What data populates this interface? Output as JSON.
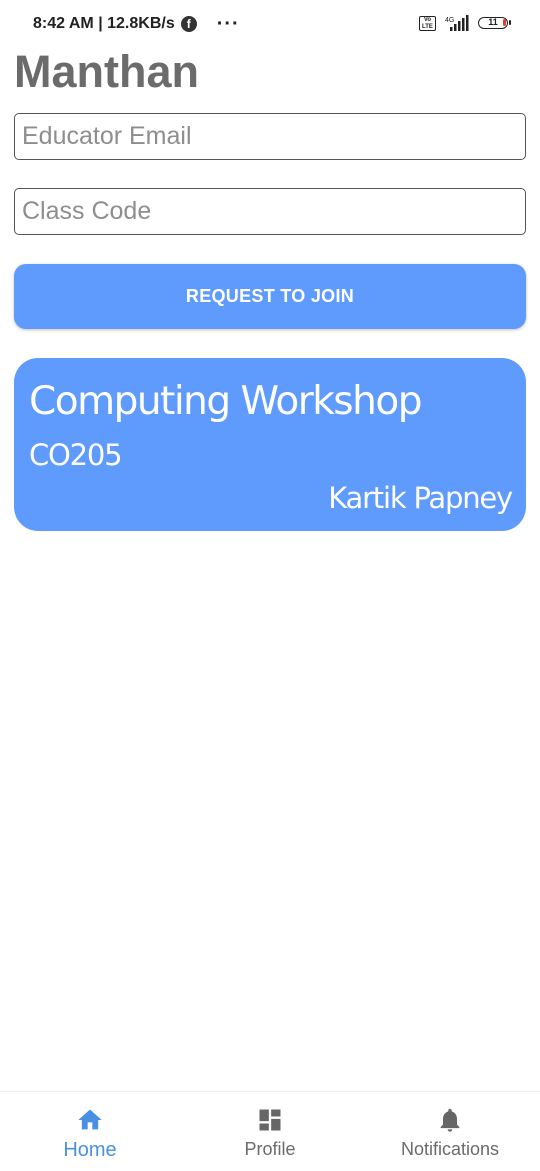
{
  "status_bar": {
    "time_and_speed": "8:42 AM | 12.8KB/s",
    "facebook_glyph": "f",
    "more_glyph": "···",
    "volte_label": "Vo LTE",
    "network_label": "4G",
    "battery_level": "11",
    "battery_color": "#e53935"
  },
  "app": {
    "title": "Manthan",
    "accent_color": "#5e9bfc"
  },
  "form": {
    "email_placeholder": "Educator Email",
    "email_value": "",
    "class_code_placeholder": "Class Code",
    "class_code_value": "",
    "join_button_label": "REQUEST TO JOIN"
  },
  "classes": [
    {
      "name": "Computing Workshop",
      "code": "CO205",
      "educator": "Kartik Papney"
    }
  ],
  "bottom_nav": {
    "active_color": "#4a90e2",
    "items": [
      {
        "label": "Home",
        "icon": "home-icon",
        "active": true
      },
      {
        "label": "Profile",
        "icon": "dashboard-icon",
        "active": false
      },
      {
        "label": "Notifications",
        "icon": "bell-icon",
        "active": false
      }
    ]
  }
}
